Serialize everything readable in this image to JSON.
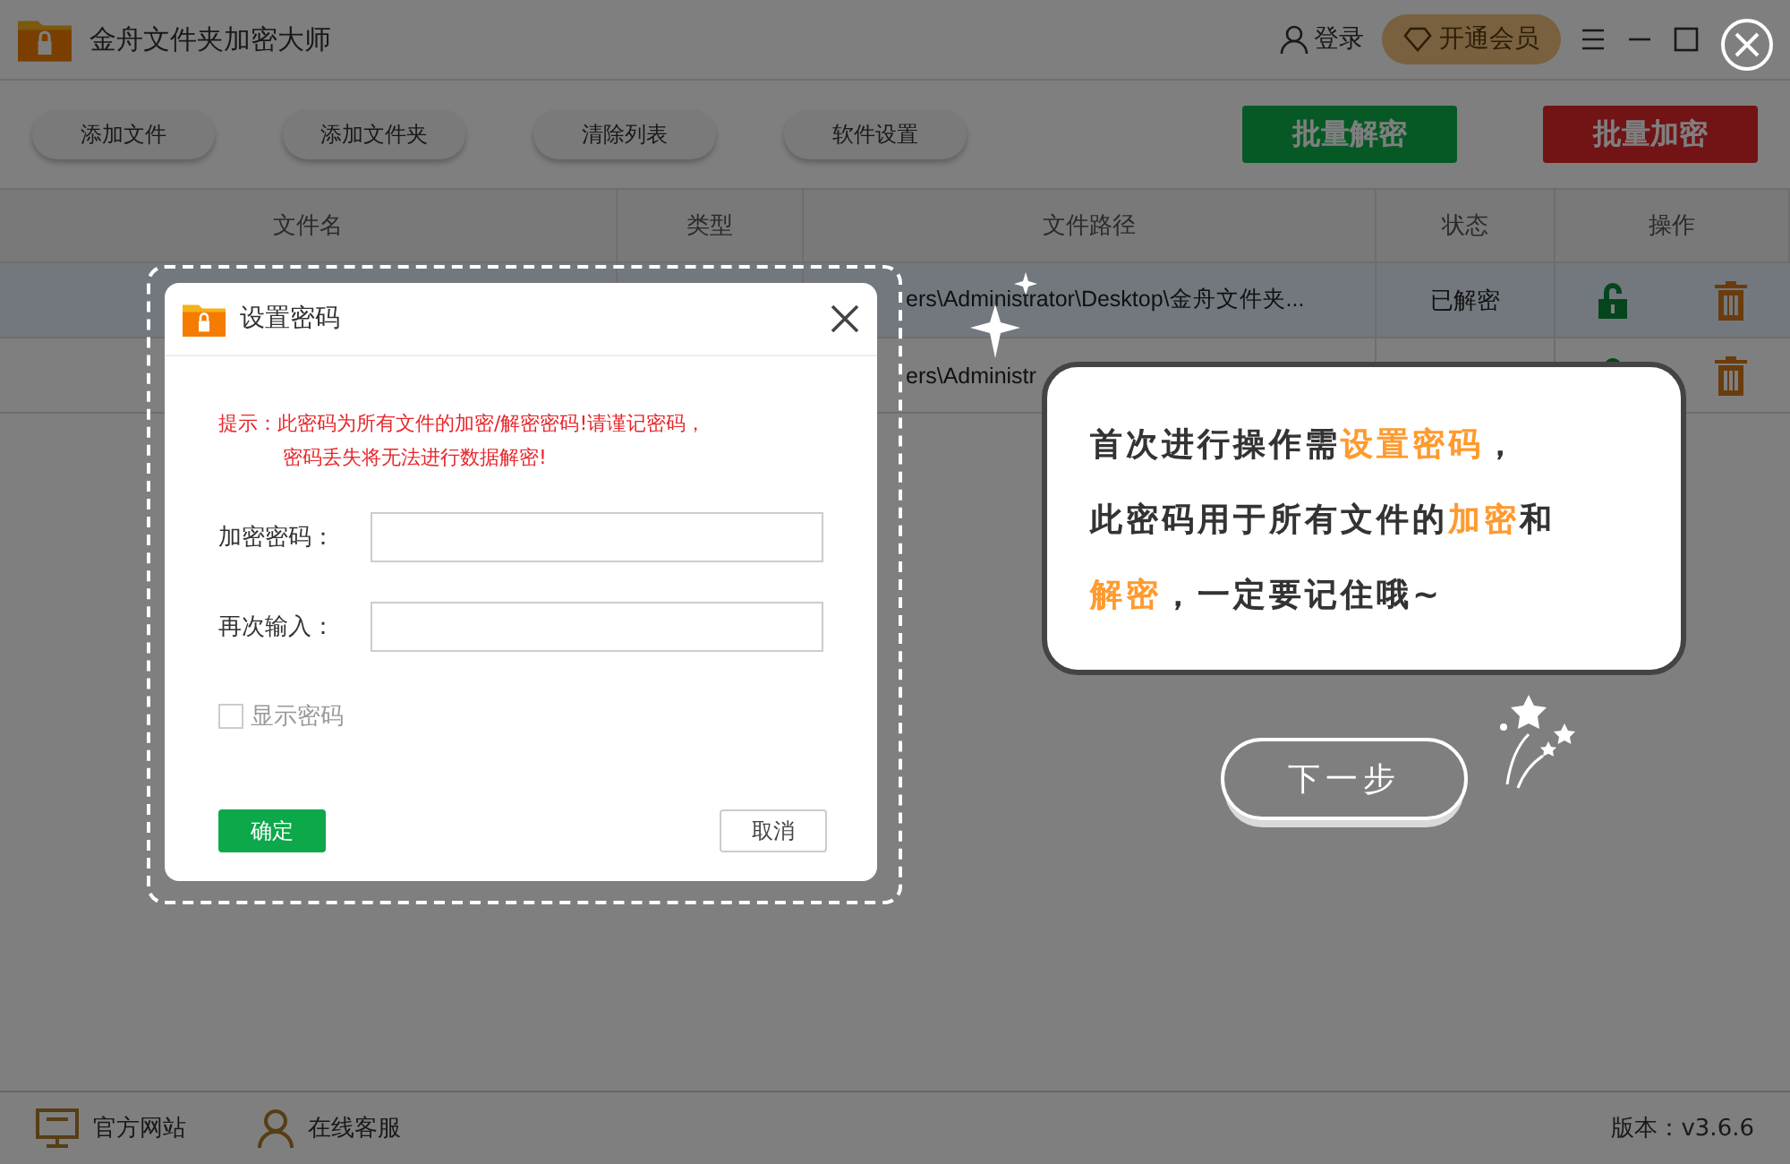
{
  "window": {
    "title": "金舟文件夹加密大师",
    "login": "登录",
    "vip": "开通会员"
  },
  "toolbar": {
    "buttons": [
      "添加文件",
      "添加文件夹",
      "清除列表",
      "软件设置"
    ],
    "actions": [
      {
        "label": "批量解密",
        "kind": "decrypt"
      },
      {
        "label": "批量加密",
        "kind": "encrypt"
      }
    ]
  },
  "table": {
    "columns": [
      "文件名",
      "类型",
      "文件路径",
      "状态",
      "操作"
    ],
    "rows": [
      {
        "path": "ers\\Administrator\\Desktop\\金舟文件夹...",
        "status": "已解密",
        "selected": true
      },
      {
        "path": "ers\\Administr",
        "selected": false
      }
    ]
  },
  "dialog": {
    "title": "设置密码",
    "hint": [
      "提示：此密码为所有文件的加密/解密密码!请谨记密码，",
      "密码丢失将无法进行数据解密!"
    ],
    "fields": [
      {
        "label": "加密密码："
      },
      {
        "label": "再次输入："
      }
    ],
    "show_password": {
      "label": "显示密码",
      "checked": false
    },
    "ok": "确定",
    "cancel": "取消"
  },
  "guide": {
    "lines": [
      [
        {
          "text": "首次进行操作需",
          "highlight": false
        },
        {
          "text": "设置密码",
          "highlight": true
        },
        {
          "text": "，",
          "highlight": false
        }
      ],
      [
        {
          "text": "此密码用于所有文件的",
          "highlight": false
        },
        {
          "text": "加密",
          "highlight": true
        },
        {
          "text": "和",
          "highlight": false
        }
      ],
      [
        {
          "text": "解密",
          "highlight": true
        },
        {
          "text": "，一定要记住哦~",
          "highlight": false
        }
      ]
    ],
    "next": "下一步"
  },
  "footer": {
    "links": [
      {
        "label": "官方网站",
        "kind": "site"
      },
      {
        "label": "在线客服",
        "kind": "service"
      }
    ],
    "version": "版本：v3.6.6"
  }
}
